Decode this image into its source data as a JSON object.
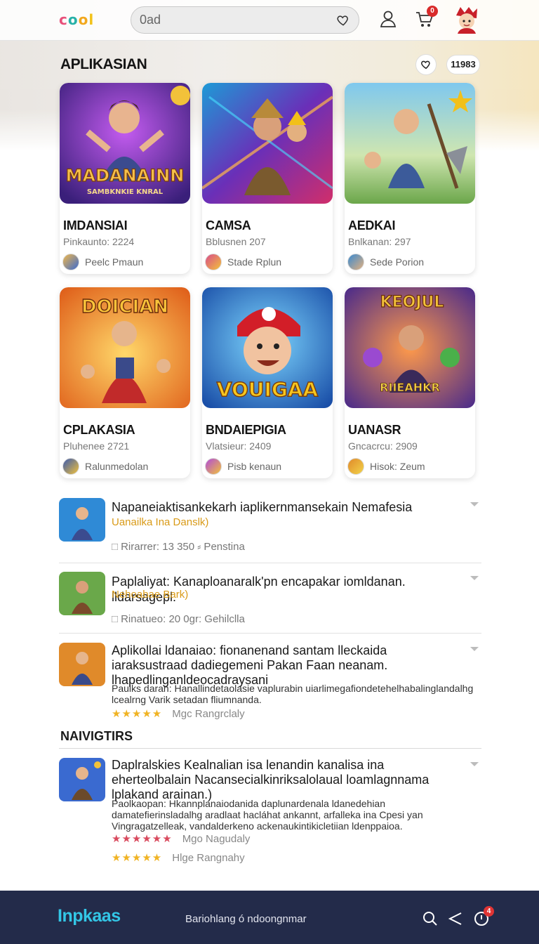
{
  "header": {
    "logo_text": [
      "c",
      "o",
      "o",
      "l"
    ],
    "search_value": "0ad",
    "cart_badge": "0"
  },
  "section": {
    "title": "APLIKASIAN",
    "count": "11983"
  },
  "apps": [
    {
      "name": "IMDANSIAI",
      "meta": "Pinkaunto: 2224",
      "dev": "Peelc Pmaun",
      "art_caption": "MADANAINN",
      "art_caption2": "SAMBKNKIE KNRAL"
    },
    {
      "name": "CAMSA",
      "meta": "Bblusnen 207",
      "dev": "Stade Rplun"
    },
    {
      "name": "AEDKAI",
      "meta": "Bnlkanan: 297",
      "dev": "Sede Porion"
    },
    {
      "name": "CPLAKASIA",
      "meta": "Pluhenee 2721",
      "dev": "Ralunmedolan",
      "art_caption": "DOICIAN"
    },
    {
      "name": "BNDAIEPIGIA",
      "meta": "Vlatsieur: 2409",
      "dev": "Pisb kenaun",
      "art_caption": "VOUIGAA"
    },
    {
      "name": "UANASR",
      "meta": "Gncacrcu: 2909",
      "dev": "Hisok: Zeum",
      "art_caption": "KEOJUL",
      "art_caption2": "RIIEAHKR"
    }
  ],
  "list": [
    {
      "title": "Napaneiaktisankekarh iaplikernmansekain Nemafesia",
      "sub": "Uanailka Ina Danslk)",
      "stat": "Rirarrer: 13 350 ⸗ Penstina"
    },
    {
      "title": "Paplaliyat: Kanaploanaralk'pn encapakar iomldanan. lldarsagepl.",
      "sub": "Nehoabae Bark)",
      "stat": "Rinatueo: 20 0gr: Gehilclla"
    },
    {
      "title": "Aplikollai ldanaiao: fionanenand santam lleckaida iaraksustraad dadiegemeni Pakan Faan neanam. lhapedlinganldeocadraysani",
      "desc": "Paulks daran: Hanallindetaolasie vaplurabin uiarlimegafiondetehelhabalinglandalhg lcealrng Varik setadan fliumnanda.",
      "rating": "Mgc Rangrclaly",
      "stars": "★★★★★"
    }
  ],
  "subsection": {
    "title": "NAIVIGTIRS"
  },
  "list2": [
    {
      "title": "Daplralskies Kealnalian isa lenandin kanalisa ina eherteolbalain Nacansecialkinriksalolaual loamlagnnama lplakand arainan.)",
      "desc": "Paolkaopan: Hkannplanaiodanida daplunardenala ldanedehian damatefierinsladalhg aradlaat hacláhat ankannt, arfalleka ina Cpesi yan Vingragatzelleak, vandalderkeno ackenaukintikicletiian ldenppaioa.",
      "rating1": "Mgo Nagudaly",
      "stars1": "★★★★★★",
      "rating2": "Hlge Rangnahy",
      "stars2": "★★★★★"
    }
  ],
  "footer": {
    "brand": "Inpkaas",
    "tagline": "Bariohlang ó ndoongnmar",
    "badge": "4"
  }
}
